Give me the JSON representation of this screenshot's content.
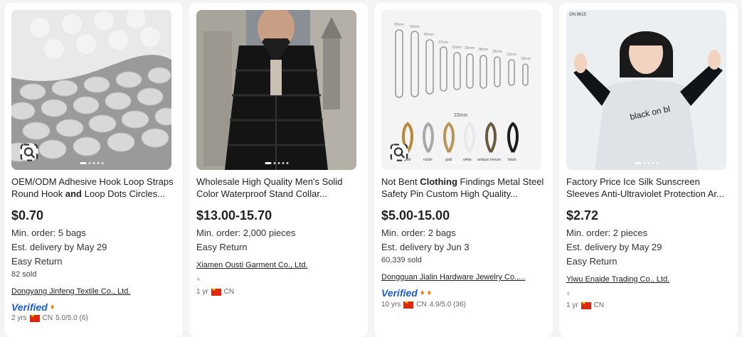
{
  "colors": {
    "verified": "#1a5cd6",
    "diamond_gold": "#ff7a00",
    "diamond_gray": "#cfcfcf",
    "flag": "#de2910"
  },
  "cards": [
    {
      "image": "adhesive-dot-sheet",
      "title_parts": [
        "OEM/ODM Adhesive Hook Loop Straps Round Hook ",
        "and",
        " Loop Dots Circles..."
      ],
      "price": "$0.70",
      "min_order": "Min. order: 5 bags",
      "delivery": "Est. delivery by May 29",
      "easy_return": "Easy Return",
      "sold": "82 sold",
      "supplier": "Dongyang Jinfeng Textile Co., Ltd.",
      "verified": "Verified",
      "years": "2 yrs",
      "country": "CN",
      "rating": "5.0/5.0 (6)"
    },
    {
      "image": "black-puffer-coat",
      "title_parts": [
        "Wholesale High Quality Men's Solid Color Waterproof Stand Collar..."
      ],
      "price": "$13.00-15.70",
      "min_order": "Min. order: 2,000 pieces",
      "easy_return": "Easy Return",
      "supplier": "Xiamen Ousti Garment Co., Ltd.",
      "years": "1 yr",
      "country": "CN"
    },
    {
      "image": "safety-pins",
      "title_parts": [
        "Not Bent ",
        "Clothing",
        " Findings Metal Steel Safety Pin Custom High Quality..."
      ],
      "price": "$5.00-15.00",
      "min_order": "Min. order: 2 bags",
      "delivery": "Est. delivery by Jun 3",
      "sold": "60,339 sold",
      "supplier": "Dongguan Jialin Hardware Jewelry Co.,...",
      "verified": "Verified",
      "years": "10 yrs",
      "country": "CN",
      "rating": "4.9/5.0 (36)",
      "pin_sizes": [
        "55mm",
        "55mm",
        "45mm",
        "37mm",
        "32mm",
        "30mm",
        "28mm",
        "26mm",
        "22mm",
        "18mm"
      ],
      "pin_center_label": "22mm",
      "pin_colors": [
        "gold",
        "nickle",
        "gold",
        "white",
        "antique bronze",
        "black"
      ]
    },
    {
      "image": "woman-sun-sleeves",
      "title_parts": [
        "Factory Price Ice Silk Sunscreen Sleeves Anti-Ultraviolet Protection Ar..."
      ],
      "price": "$2.72",
      "min_order": "Min. order: 2 pieces",
      "delivery": "Est. delivery by May 29",
      "easy_return": "Easy Return",
      "supplier": "Yiwu Enaide Trading Co., Ltd.",
      "years": "1 yr",
      "country": "CN",
      "tag": "ON.9615",
      "shirt_text": "black on bl"
    }
  ]
}
